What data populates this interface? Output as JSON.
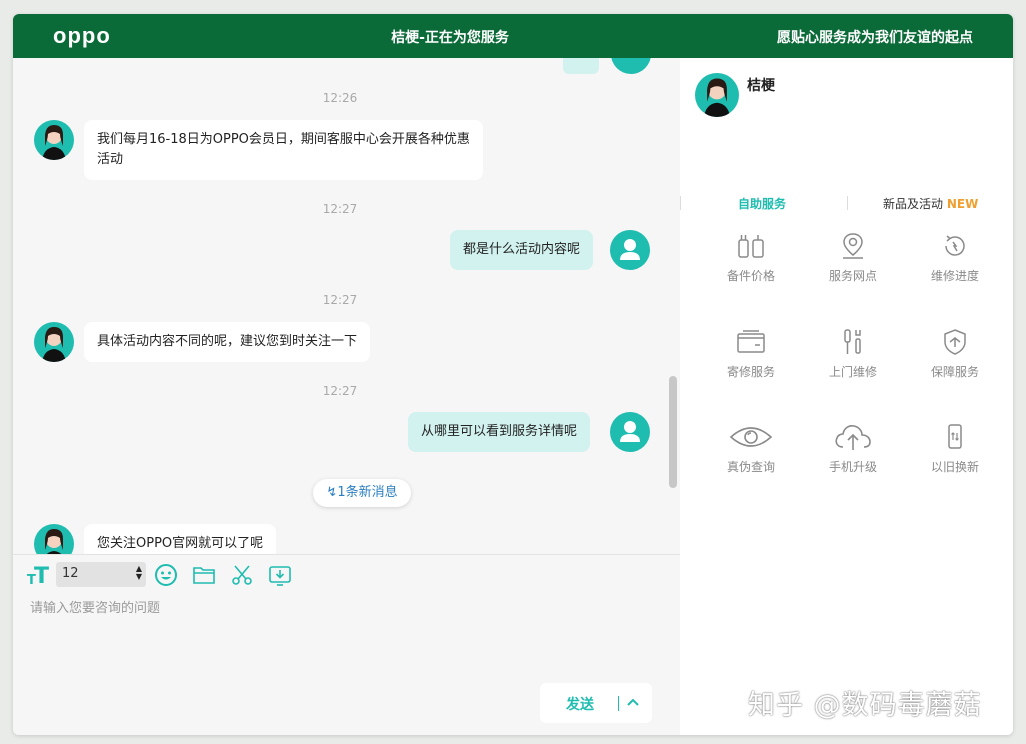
{
  "header": {
    "logo": "oppo",
    "title": "桔梗-正在为您服务",
    "slogan": "愿贴心服务成为我们友谊的起点",
    "bg_color": "#0b6b38"
  },
  "chat": {
    "messages": [
      {
        "time": "12:26",
        "from": "agent",
        "text": "我们每月16-18日为OPPO会员日，期间客服中心会开展各种优惠活动"
      },
      {
        "time": "12:27",
        "from": "user",
        "text": "都是什么活动内容呢"
      },
      {
        "time": "12:27",
        "from": "agent",
        "text": "具体活动内容不同的呢，建议您到时关注一下"
      },
      {
        "time": "12:27",
        "from": "user",
        "text": "从哪里可以看到服务详情呢"
      },
      {
        "from": "agent",
        "text": "您关注OPPO官网就可以了呢"
      }
    ],
    "new_message_label": "1条新消息"
  },
  "input": {
    "font_size": "12",
    "placeholder": "请输入您要咨询的问题",
    "send_label": "发送"
  },
  "side": {
    "agent_name": "桔梗",
    "tabs": {
      "self_service": "自助服务",
      "new_products": "新品及活动",
      "new_badge": "NEW"
    },
    "services": [
      {
        "label": "备件价格",
        "icon": "parts-icon"
      },
      {
        "label": "服务网点",
        "icon": "location-icon"
      },
      {
        "label": "维修进度",
        "icon": "progress-icon"
      },
      {
        "label": "寄修服务",
        "icon": "mail-box-icon"
      },
      {
        "label": "上门维修",
        "icon": "tools-icon"
      },
      {
        "label": "保障服务",
        "icon": "shield-icon"
      },
      {
        "label": "真伪查询",
        "icon": "eye-icon"
      },
      {
        "label": "手机升级",
        "icon": "cloud-upload-icon"
      },
      {
        "label": "以旧换新",
        "icon": "phone-swap-icon"
      }
    ]
  },
  "watermark": "知乎 @数码毒蘑菇",
  "colors": {
    "accent": "#1fbcb0",
    "user_bubble": "#d2f2ef",
    "new_badge": "#f0a030"
  }
}
